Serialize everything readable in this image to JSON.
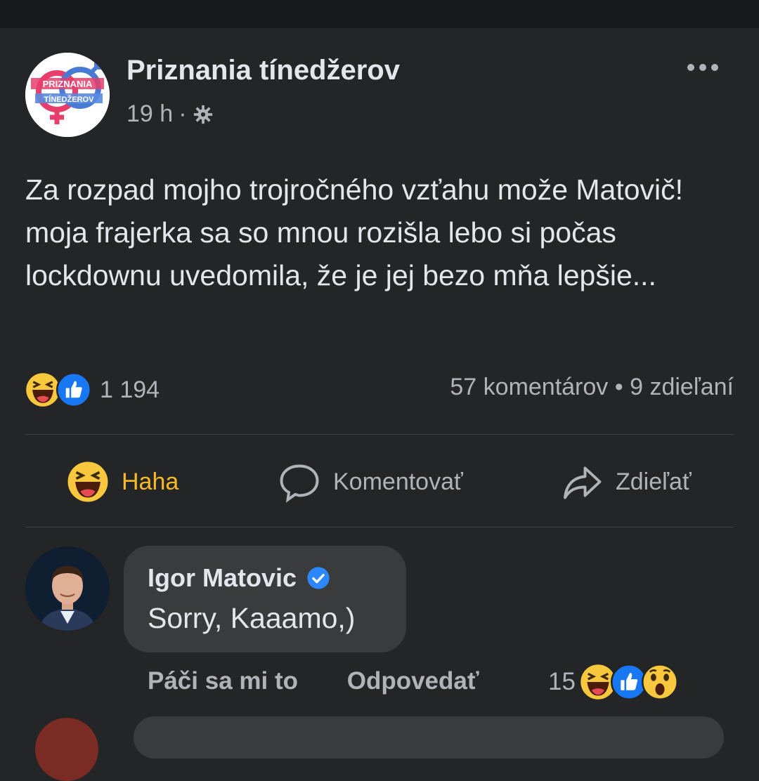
{
  "post": {
    "page_name": "Priznania tínedžerov",
    "time": "19 h",
    "meta_separator": "·",
    "privacy_icon": "gear-icon",
    "logo_text_top": "PRIZNANIA",
    "logo_text_bottom": "TÍNEDŽEROV",
    "text": "Za rozpad mojho trojročného vzťahu može Matovič! moja frajerka sa so mnou rozišla lebo si počas lockdownu uvedomila, že je jej bezo mňa lepšie...",
    "reactions": {
      "icons": [
        "haha-icon",
        "like-icon"
      ],
      "count": "1 194"
    },
    "stats": "57 komentárov • 9 zdieľaní"
  },
  "actions": {
    "haha_label": "Haha",
    "comment_label": "Komentovať",
    "share_label": "Zdieľať",
    "haha_color": "#f7b928"
  },
  "comment": {
    "author": "Igor Matovic",
    "verified": true,
    "text": "Sorry, Kaaamo,)",
    "like_label": "Páči sa mi to",
    "reply_label": "Odpovedať",
    "reaction_count": "15",
    "reaction_icons": [
      "haha-icon",
      "like-icon",
      "wow-icon"
    ]
  },
  "colors": {
    "background": "#242526",
    "text": "#e4e6eb",
    "secondary": "#b0b3b8",
    "like_blue": "#1877f2",
    "verified_blue": "#2d88ff"
  }
}
